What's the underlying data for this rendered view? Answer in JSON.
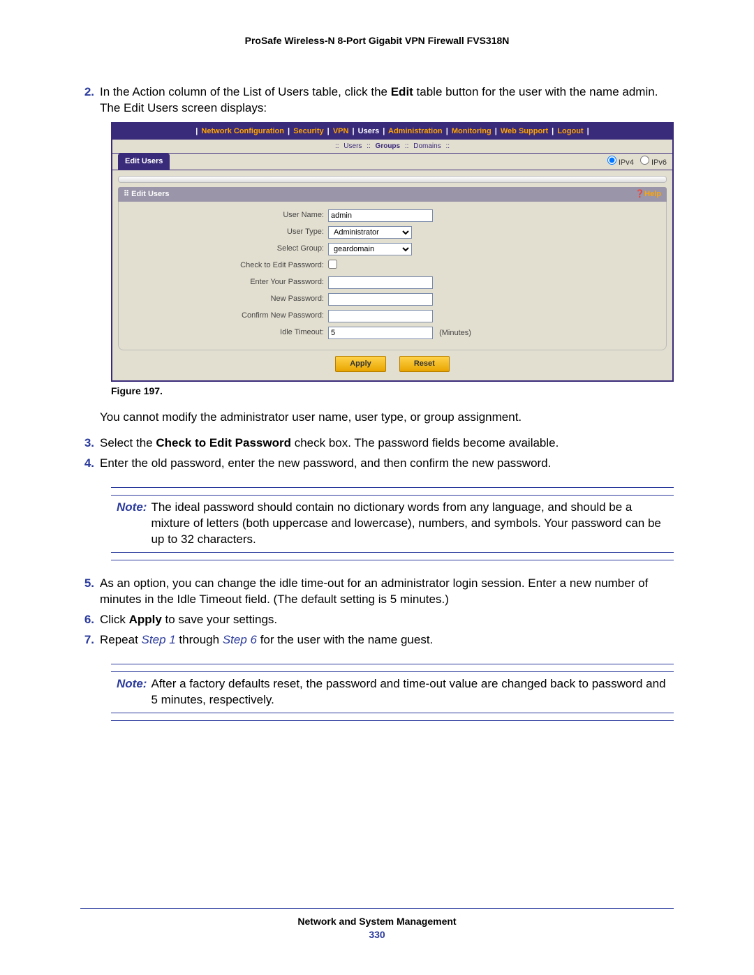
{
  "header": {
    "product_title": "ProSafe Wireless-N 8-Port Gigabit VPN Firewall FVS318N"
  },
  "steps": {
    "s2_num": "2.",
    "s2_a": "In the Action column of the List of Users table, click the ",
    "s2_b": "Edit",
    "s2_c": " table button for the user with the name admin. The Edit Users screen displays:",
    "s3_num": "3.",
    "s3_a": "Select the ",
    "s3_b": "Check to Edit Password",
    "s3_c": " check box. The password fields become available.",
    "s4_num": "4.",
    "s4": "Enter the old password, enter the new password, and then confirm the new password.",
    "s5_num": "5.",
    "s5": "As an option, you can change the idle time-out for an administrator login session. Enter a new number of minutes in the Idle Timeout field. (The default setting is 5 minutes.)",
    "s6_num": "6.",
    "s6_a": "Click ",
    "s6_b": "Apply",
    "s6_c": " to save your settings.",
    "s7_num": "7.",
    "s7_a": "Repeat ",
    "s7_b": "Step 1",
    "s7_c": " through ",
    "s7_d": "Step 6",
    "s7_e": " for the user with the name guest."
  },
  "after_fig": "You cannot modify the administrator user name, user type, or group assignment.",
  "figure_label": "Figure 197.",
  "note1": {
    "label": "Note:",
    "text": "The ideal password should contain no dictionary words from any language, and should be a mixture of letters (both uppercase and lowercase), numbers, and symbols. Your password can be up to 32 characters."
  },
  "note2": {
    "label": "Note:",
    "text": "After a factory defaults reset, the password and time-out value are changed back to password and 5 minutes, respectively."
  },
  "screenshot": {
    "nav": {
      "network": "Network Configuration",
      "security": "Security",
      "vpn": "VPN",
      "users": "Users",
      "admin": "Administration",
      "monitoring": "Monitoring",
      "websupport": "Web Support",
      "logout": "Logout"
    },
    "subnav": {
      "users": "Users",
      "groups": "Groups",
      "domains": "Domains"
    },
    "tab": "Edit Users",
    "ipv4": "IPv4",
    "ipv6": "IPv6",
    "panel_title": "Edit Users",
    "help": "Help",
    "labels": {
      "user_name": "User Name:",
      "user_type": "User Type:",
      "select_group": "Select Group:",
      "check_edit": "Check to Edit Password:",
      "enter_pwd": "Enter Your Password:",
      "new_pwd": "New Password:",
      "confirm_pwd": "Confirm New Password:",
      "idle": "Idle Timeout:",
      "minutes": "(Minutes)"
    },
    "values": {
      "user_name": "admin",
      "user_type": "Administrator",
      "select_group": "geardomain",
      "idle": "5"
    },
    "buttons": {
      "apply": "Apply",
      "reset": "Reset"
    }
  },
  "footer": {
    "section": "Network and System Management",
    "page": "330"
  }
}
